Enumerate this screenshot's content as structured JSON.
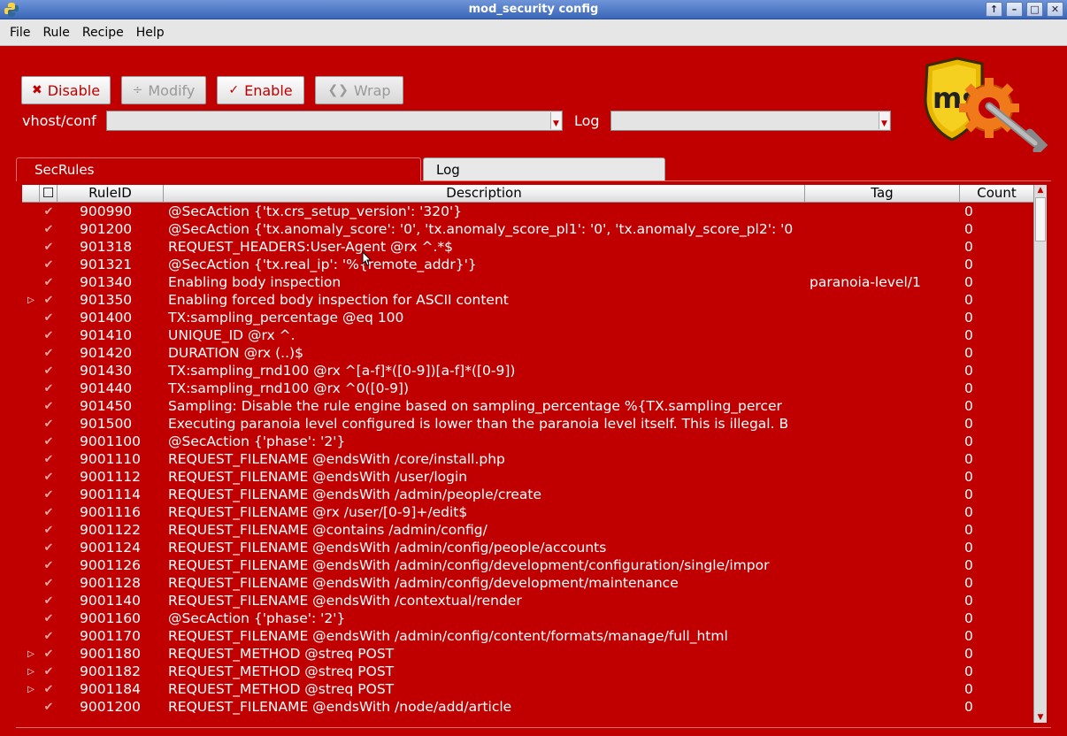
{
  "window": {
    "title": "mod_security config"
  },
  "menu": [
    "File",
    "Rule",
    "Recipe",
    "Help"
  ],
  "toolbar": {
    "disable": "Disable",
    "modify": "Modify",
    "enable": "Enable",
    "wrap": "Wrap"
  },
  "fields": {
    "vhost_label": "vhost/conf",
    "vhost_value": "",
    "log_label": "Log",
    "log_value": ""
  },
  "tabs": [
    "SecRules",
    "Log"
  ],
  "table": {
    "columns": [
      "RuleID",
      "Description",
      "Tag",
      "Count"
    ],
    "rows": [
      {
        "expand": false,
        "id": "900990",
        "desc": "@SecAction {'tx.crs_setup_version': '320'}",
        "tag": "",
        "count": "0"
      },
      {
        "expand": false,
        "id": "901200",
        "desc": "@SecAction {'tx.anomaly_score': '0', 'tx.anomaly_score_pl1': '0', 'tx.anomaly_score_pl2': '0",
        "tag": "",
        "count": "0"
      },
      {
        "expand": false,
        "id": "901318",
        "desc": "REQUEST_HEADERS:User-Agent     @rx ^.*$",
        "tag": "",
        "count": "0"
      },
      {
        "expand": false,
        "id": "901321",
        "desc": "@SecAction {'tx.real_ip': '%{remote_addr}'}",
        "tag": "",
        "count": "0"
      },
      {
        "expand": false,
        "id": "901340",
        "desc": "Enabling body inspection",
        "tag": "paranoia-level/1",
        "count": "0"
      },
      {
        "expand": true,
        "id": "901350",
        "desc": "Enabling forced body inspection for ASCII content",
        "tag": "",
        "count": "0"
      },
      {
        "expand": false,
        "id": "901400",
        "desc": "TX:sampling_percentage     @eq 100",
        "tag": "",
        "count": "0"
      },
      {
        "expand": false,
        "id": "901410",
        "desc": "UNIQUE_ID     @rx ^.",
        "tag": "",
        "count": "0"
      },
      {
        "expand": false,
        "id": "901420",
        "desc": "DURATION     @rx (..)$",
        "tag": "",
        "count": "0"
      },
      {
        "expand": false,
        "id": "901430",
        "desc": "TX:sampling_rnd100     @rx ^[a-f]*([0-9])[a-f]*([0-9])",
        "tag": "",
        "count": "0"
      },
      {
        "expand": false,
        "id": "901440",
        "desc": "TX:sampling_rnd100     @rx ^0([0-9])",
        "tag": "",
        "count": "0"
      },
      {
        "expand": false,
        "id": "901450",
        "desc": "Sampling: Disable the rule engine based on sampling_percentage  %{TX.sampling_percer",
        "tag": "",
        "count": "0"
      },
      {
        "expand": false,
        "id": "901500",
        "desc": "Executing paranoia level configured is lower than the paranoia level itself. This is illegal. B",
        "tag": "",
        "count": "0"
      },
      {
        "expand": false,
        "id": "9001100",
        "desc": "@SecAction {'phase': '2'}",
        "tag": "",
        "count": "0"
      },
      {
        "expand": false,
        "id": "9001110",
        "desc": "REQUEST_FILENAME     @endsWith /core/install.php",
        "tag": "",
        "count": "0"
      },
      {
        "expand": false,
        "id": "9001112",
        "desc": "REQUEST_FILENAME     @endsWith /user/login",
        "tag": "",
        "count": "0"
      },
      {
        "expand": false,
        "id": "9001114",
        "desc": "REQUEST_FILENAME     @endsWith /admin/people/create",
        "tag": "",
        "count": "0"
      },
      {
        "expand": false,
        "id": "9001116",
        "desc": "REQUEST_FILENAME     @rx /user/[0-9]+/edit$",
        "tag": "",
        "count": "0"
      },
      {
        "expand": false,
        "id": "9001122",
        "desc": "REQUEST_FILENAME     @contains /admin/config/",
        "tag": "",
        "count": "0"
      },
      {
        "expand": false,
        "id": "9001124",
        "desc": "REQUEST_FILENAME     @endsWith /admin/config/people/accounts",
        "tag": "",
        "count": "0"
      },
      {
        "expand": false,
        "id": "9001126",
        "desc": "REQUEST_FILENAME     @endsWith /admin/config/development/configuration/single/impor",
        "tag": "",
        "count": "0"
      },
      {
        "expand": false,
        "id": "9001128",
        "desc": "REQUEST_FILENAME     @endsWith /admin/config/development/maintenance",
        "tag": "",
        "count": "0"
      },
      {
        "expand": false,
        "id": "9001140",
        "desc": "REQUEST_FILENAME     @endsWith /contextual/render",
        "tag": "",
        "count": "0"
      },
      {
        "expand": false,
        "id": "9001160",
        "desc": "@SecAction {'phase': '2'}",
        "tag": "",
        "count": "0"
      },
      {
        "expand": false,
        "id": "9001170",
        "desc": "REQUEST_FILENAME     @endsWith /admin/config/content/formats/manage/full_html",
        "tag": "",
        "count": "0"
      },
      {
        "expand": true,
        "id": "9001180",
        "desc": "REQUEST_METHOD     @streq POST",
        "tag": "",
        "count": "0"
      },
      {
        "expand": true,
        "id": "9001182",
        "desc": "REQUEST_METHOD     @streq POST",
        "tag": "",
        "count": "0"
      },
      {
        "expand": true,
        "id": "9001184",
        "desc": "REQUEST_METHOD     @streq POST",
        "tag": "",
        "count": "0"
      },
      {
        "expand": false,
        "id": "9001200",
        "desc": "REQUEST_FILENAME     @endsWith /node/add/article",
        "tag": "",
        "count": "0"
      }
    ]
  },
  "logo": {
    "text": "ms"
  },
  "colors": {
    "background": "#c00000",
    "text": "#ffffff"
  }
}
